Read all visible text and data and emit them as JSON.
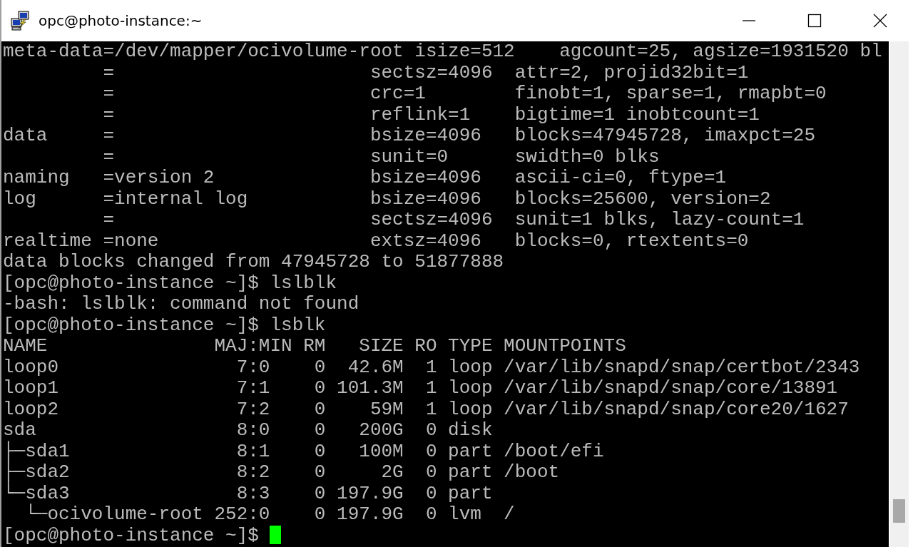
{
  "window": {
    "title": "opc@photo-instance:~"
  },
  "terminal": {
    "lines": [
      "meta-data=/dev/mapper/ocivolume-root isize=512    agcount=25, agsize=1931520 bl",
      "         =                       sectsz=4096  attr=2, projid32bit=1",
      "         =                       crc=1        finobt=1, sparse=1, rmapbt=0",
      "         =                       reflink=1    bigtime=1 inobtcount=1",
      "data     =                       bsize=4096   blocks=47945728, imaxpct=25",
      "         =                       sunit=0      swidth=0 blks",
      "naming   =version 2              bsize=4096   ascii-ci=0, ftype=1",
      "log      =internal log           bsize=4096   blocks=25600, version=2",
      "         =                       sectsz=4096  sunit=1 blks, lazy-count=1",
      "realtime =none                   extsz=4096   blocks=0, rtextents=0",
      "data blocks changed from 47945728 to 51877888",
      "[opc@photo-instance ~]$ lslblk",
      "-bash: lslblk: command not found",
      "[opc@photo-instance ~]$ lsblk",
      "NAME               MAJ:MIN RM   SIZE RO TYPE MOUNTPOINTS",
      "loop0                7:0    0  42.6M  1 loop /var/lib/snapd/snap/certbot/2343",
      "loop1                7:1    0 101.3M  1 loop /var/lib/snapd/snap/core/13891",
      "loop2                7:2    0    59M  1 loop /var/lib/snapd/snap/core20/1627",
      "sda                  8:0    0   200G  0 disk",
      "├─sda1               8:1    0   100M  0 part /boot/efi",
      "├─sda2               8:2    0     2G  0 part /boot",
      "└─sda3               8:3    0 197.9G  0 part",
      "  └─ocivolume-root 252:0    0 197.9G  0 lvm  /",
      "[opc@photo-instance ~]$ "
    ]
  }
}
